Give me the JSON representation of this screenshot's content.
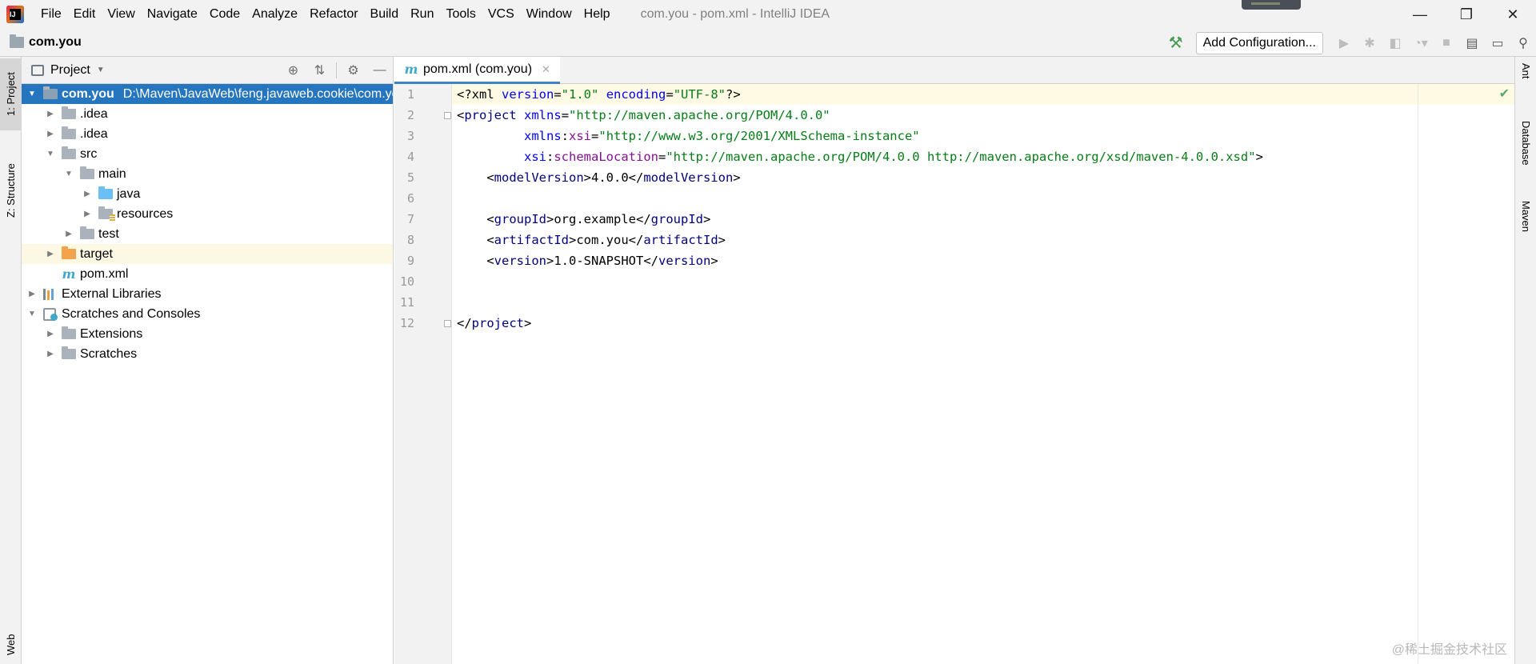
{
  "title_bar": {
    "menu": [
      "File",
      "Edit",
      "View",
      "Navigate",
      "Code",
      "Analyze",
      "Refactor",
      "Build",
      "Run",
      "Tools",
      "VCS",
      "Window",
      "Help"
    ],
    "window_title": "com.you - pom.xml - IntelliJ IDEA",
    "controls": {
      "minimize": "—",
      "restore": "❐",
      "close": "✕"
    }
  },
  "nav_bar": {
    "project_name": "com.you",
    "add_configuration_label": "Add Configuration..."
  },
  "left_tool_tabs": [
    "1: Project",
    "Z: Structure",
    "Web"
  ],
  "right_tool_tabs": [
    "Ant",
    "Database",
    "Maven"
  ],
  "project_panel": {
    "title": "Project",
    "tree": [
      {
        "name": "com.you",
        "path": "D:\\Maven\\JavaWeb\\feng.javaweb.cookie\\com.you",
        "depth": 0,
        "expanded": true,
        "icon": "project-folder-icon",
        "selected": true
      },
      {
        "name": ".idea",
        "depth": 1,
        "expanded": false,
        "icon": "folder-icon"
      },
      {
        "name": ".idea",
        "depth": 1,
        "expanded": false,
        "icon": "folder-icon"
      },
      {
        "name": "src",
        "depth": 1,
        "expanded": true,
        "icon": "folder-icon"
      },
      {
        "name": "main",
        "depth": 2,
        "expanded": true,
        "icon": "folder-icon"
      },
      {
        "name": "java",
        "depth": 3,
        "expanded": false,
        "icon": "source-folder-icon"
      },
      {
        "name": "resources",
        "depth": 3,
        "expanded": false,
        "icon": "resources-folder-icon"
      },
      {
        "name": "test",
        "depth": 2,
        "expanded": false,
        "icon": "folder-icon"
      },
      {
        "name": "target",
        "depth": 1,
        "expanded": false,
        "icon": "excluded-folder-icon",
        "highlighted": true
      },
      {
        "name": "pom.xml",
        "depth": 1,
        "leaf": true,
        "icon": "maven-file-icon"
      },
      {
        "name": "External Libraries",
        "depth": 0,
        "expanded": false,
        "icon": "libraries-icon"
      },
      {
        "name": "Scratches and Consoles",
        "depth": 0,
        "expanded": true,
        "icon": "scratches-icon"
      },
      {
        "name": "Extensions",
        "depth": 1,
        "expanded": false,
        "icon": "folder-icon"
      },
      {
        "name": "Scratches",
        "depth": 1,
        "expanded": false,
        "icon": "folder-icon"
      }
    ]
  },
  "editor": {
    "tab_label": "pom.xml (com.you)",
    "lines": [
      "<?xml version=\"1.0\" encoding=\"UTF-8\"?>",
      "<project xmlns=\"http://maven.apache.org/POM/4.0.0\"",
      "         xmlns:xsi=\"http://www.w3.org/2001/XMLSchema-instance\"",
      "         xsi:schemaLocation=\"http://maven.apache.org/POM/4.0.0 http://maven.apache.org/xsd/maven-4.0.0.xsd\">",
      "    <modelVersion>4.0.0</modelVersion>",
      "",
      "    <groupId>org.example</groupId>",
      "    <artifactId>com.you</artifactId>",
      "    <version>1.0-SNAPSHOT</version>",
      "",
      "",
      "</project>"
    ]
  },
  "watermark": "@稀土掘金技术社区"
}
